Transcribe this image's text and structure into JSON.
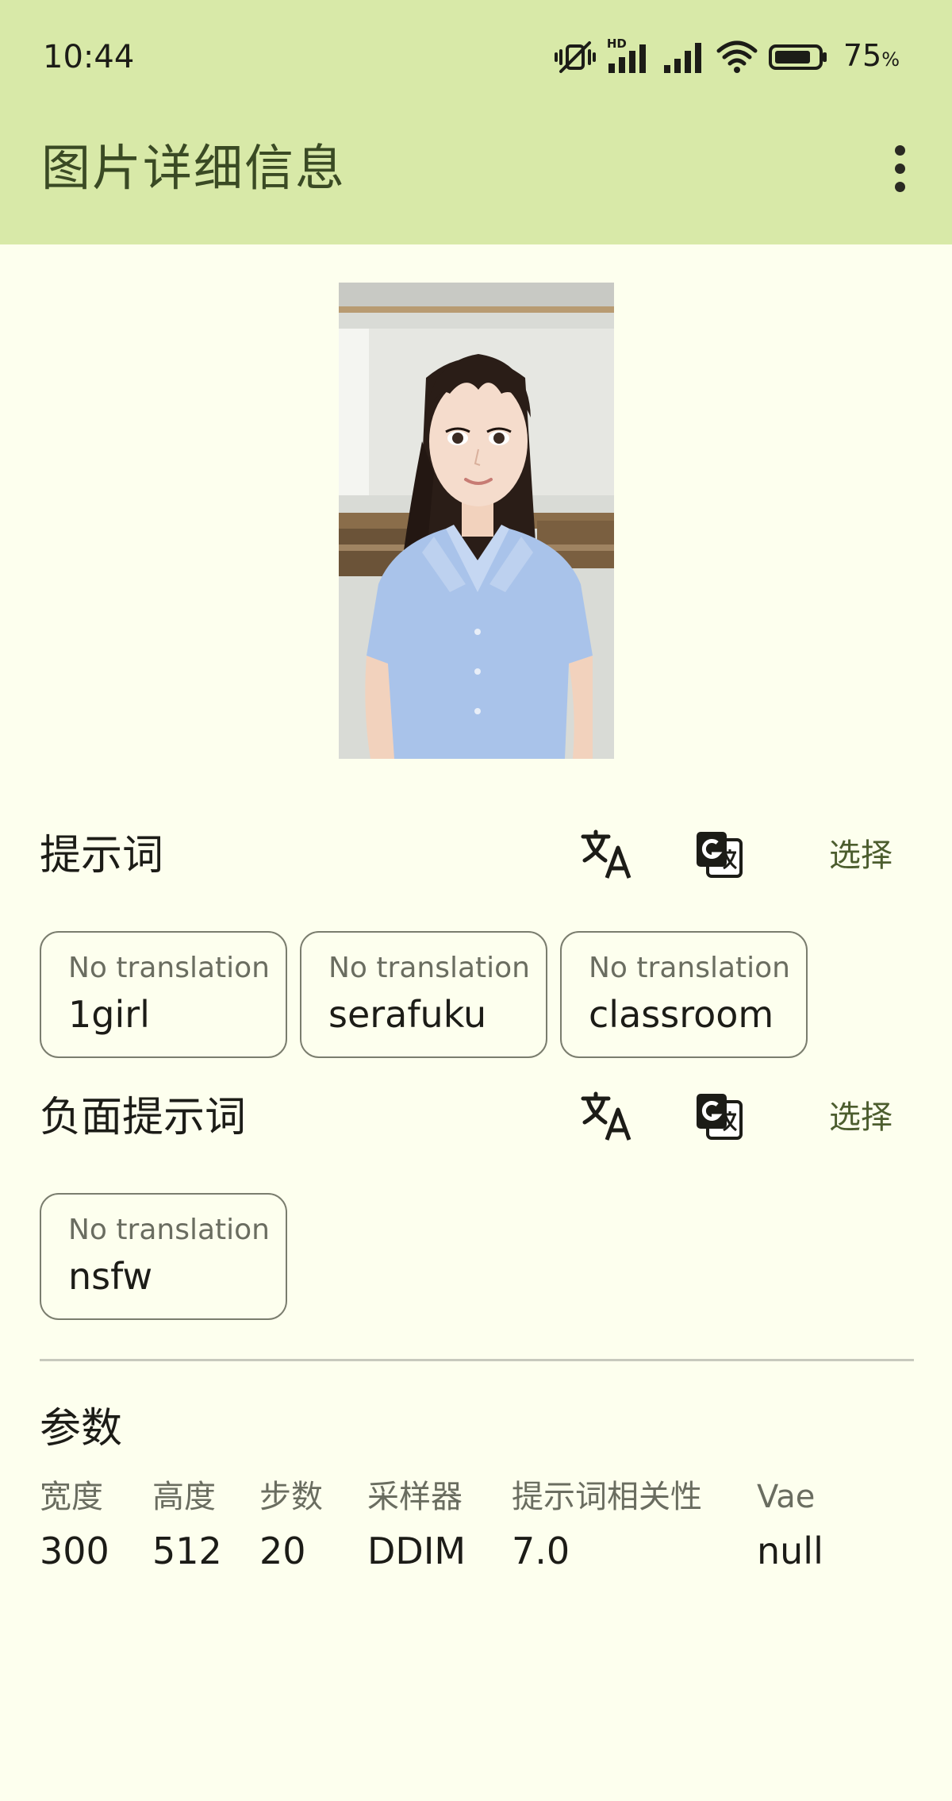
{
  "status_bar": {
    "time": "10:44",
    "network_badge": "HD",
    "battery_percent": "75",
    "battery_percent_sign": "%",
    "icons": [
      "mute-vibrate-icon",
      "signal-hd-icon",
      "signal-icon",
      "wifi-icon",
      "battery-icon"
    ]
  },
  "app_bar": {
    "title": "图片详细信息",
    "menu_icon": "more-vert-icon"
  },
  "preview": {
    "icon": "image-preview"
  },
  "prompt": {
    "title": "提示词",
    "translate_icon": "translate-icon",
    "google_translate_icon": "google-translate-icon",
    "select_label": "选择",
    "chips": [
      {
        "sub": "No translation",
        "main": "1girl"
      },
      {
        "sub": "No translation",
        "main": "serafuku"
      },
      {
        "sub": "No translation",
        "main": "classroom"
      }
    ]
  },
  "negative_prompt": {
    "title": "负面提示词",
    "translate_icon": "translate-icon",
    "google_translate_icon": "google-translate-icon",
    "select_label": "选择",
    "chips": [
      {
        "sub": "No translation",
        "main": "nsfw"
      }
    ]
  },
  "params": {
    "title": "参数",
    "items": [
      {
        "label": "宽度",
        "value": "300"
      },
      {
        "label": "高度",
        "value": "512"
      },
      {
        "label": "步数",
        "value": "20"
      },
      {
        "label": "采样器",
        "value": "DDIM"
      },
      {
        "label": "提示词相关性",
        "value": "7.0"
      },
      {
        "label": "Vae",
        "value": "null"
      }
    ]
  },
  "colors": {
    "background": "#FDFFEE",
    "app_bar": "#D8E9A8",
    "accent_text": "#4c5d2e",
    "chip_border": "#7a7d6e"
  }
}
